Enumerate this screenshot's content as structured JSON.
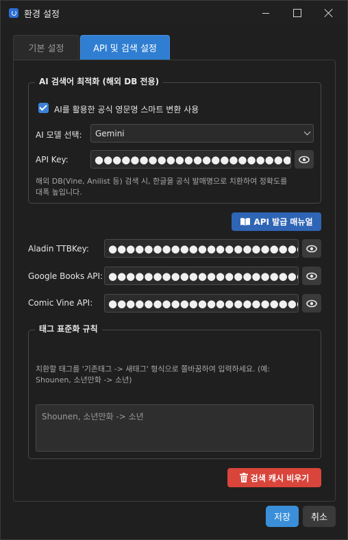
{
  "window": {
    "title": "환경 설정"
  },
  "tabs": [
    {
      "label": "기본 설정"
    },
    {
      "label": "API 및 검색 설정"
    }
  ],
  "ai_group": {
    "title": "AI 검색어 최적화 (해외 DB 전용)",
    "checkbox_label": "AI를 활용한 공식 영문명 스마트 변환 사용",
    "model_label": "AI 모델 선택:",
    "model_value": "Gemini",
    "api_key_label": "API Key:",
    "api_key_value": "●●●●●●●●●●●●●●●●●●●●●●●●●●●●●●",
    "help_line1": "해외 DB(Vine, Anilist 등) 검색 시, 한글을 공식 발매명으로 치환하여 정확도를",
    "help_line2": "대폭 높입니다."
  },
  "manual_button": {
    "label": "API 발급 매뉴얼"
  },
  "keys": [
    {
      "label": "Aladin TTBKey:",
      "value": "●●●●●●●●●●●●●●●●●●●●●●●●●●●●●●"
    },
    {
      "label": "Google Books API:",
      "value": "●●●●●●●●●●●●●●●●●●●●●●●●●●●●●●"
    },
    {
      "label": "Comic Vine API:",
      "value": "●●●●●●●●●●●●●●●●●●●●●●●●●●●●●●"
    }
  ],
  "tag_group": {
    "title": "태그 표준화 규칙",
    "help_line1": "치환할 태그를 '기존태그 -> 새태그' 형식으로 쫄바꿈하여 입력하세요. (예:",
    "help_line2": "Shounen, 소년만화 -> 소년)",
    "textarea_value": "Shounen, 소년만화 -> 소년"
  },
  "cache_button": {
    "label": "검색 캐시 비우기"
  },
  "footer": {
    "save_label": "저장",
    "cancel_label": "취소"
  },
  "colors": {
    "accent": "#2f7ed1",
    "danger": "#d9453b",
    "background": "#1f1f1f"
  }
}
